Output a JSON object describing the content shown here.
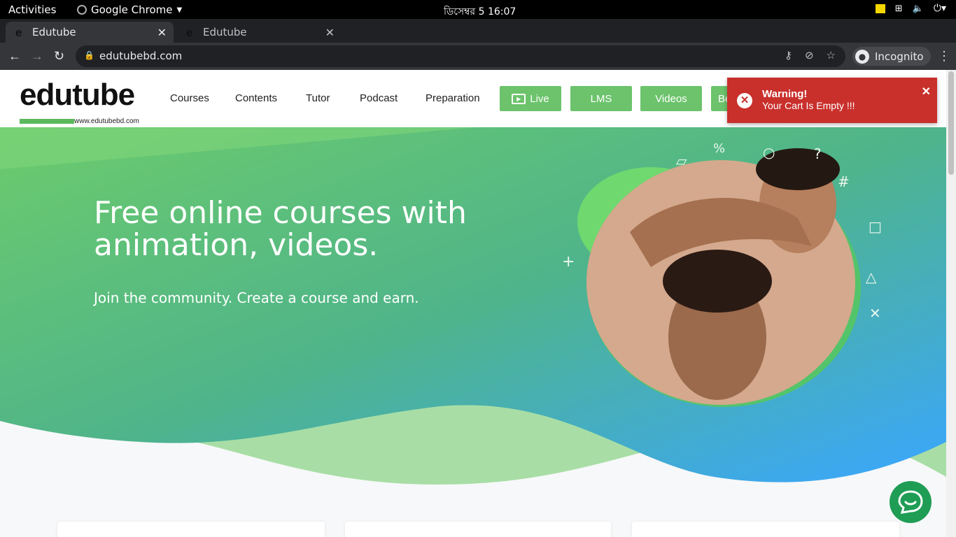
{
  "system": {
    "activities": "Activities",
    "app_name": "Google Chrome",
    "clock": "ডিসেম্বর 5  16:07"
  },
  "browser": {
    "tabs": [
      {
        "title": "Edutube"
      },
      {
        "title": "Edutube"
      }
    ],
    "url": "edutubebd.com",
    "incognito_label": "Incognito"
  },
  "site": {
    "logo_text": "edutube",
    "logo_url": "www.edutubebd.com",
    "nav": [
      "Courses",
      "Contents",
      "Tutor",
      "Podcast",
      "Preparation"
    ],
    "buttons": [
      "Live",
      "LMS",
      "Videos",
      "Be"
    ],
    "accent": "#6cc36c"
  },
  "hero": {
    "title": "Free online courses with animation, videos.",
    "subtitle": "Join the community. Create a course and earn."
  },
  "toast": {
    "title": "Warning!",
    "message": "Your Cart Is Empty !!!",
    "color": "#c9302c"
  }
}
